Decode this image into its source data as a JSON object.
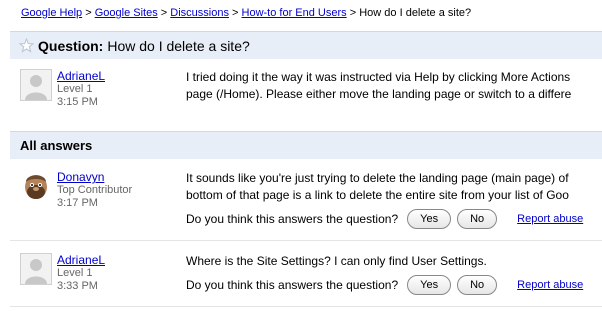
{
  "breadcrumb": {
    "items": [
      "Google Help",
      "Google Sites",
      "Discussions",
      "How-to for End Users"
    ],
    "separator": ">",
    "current": "How do I delete a site?"
  },
  "question": {
    "label": "Question:",
    "title": "How do I delete a site?",
    "author": "AdrianeL",
    "level": "Level 1",
    "time": "3:15 PM",
    "body_line1": "I tried doing it the way it was instructed via Help by clicking More Actions",
    "body_line2": "page (/Home). Please either move the landing page or switch to a differe"
  },
  "answers_header": "All answers",
  "answers": [
    {
      "author": "Donavyn",
      "level": "Top Contributor",
      "time": "3:17 PM",
      "body_line1": "It sounds like you're just trying to delete the landing page (main page) of",
      "body_line2": "bottom of that page is a link to delete the entire site from your list of Goo",
      "vote_prompt": "Do you think this answers the question?",
      "yes": "Yes",
      "no": "No",
      "report": "Report abuse"
    },
    {
      "author": "AdrianeL",
      "level": "Level 1",
      "time": "3:33 PM",
      "body_line1": "Where is the  Site Settings? I can only find User Settings.",
      "vote_prompt": "Do you think this answers the question?",
      "yes": "Yes",
      "no": "No",
      "report": "Report abuse"
    }
  ],
  "colors": {
    "link": "#0000cc",
    "header_bg": "#e8eef7",
    "meta_text": "#666666"
  }
}
